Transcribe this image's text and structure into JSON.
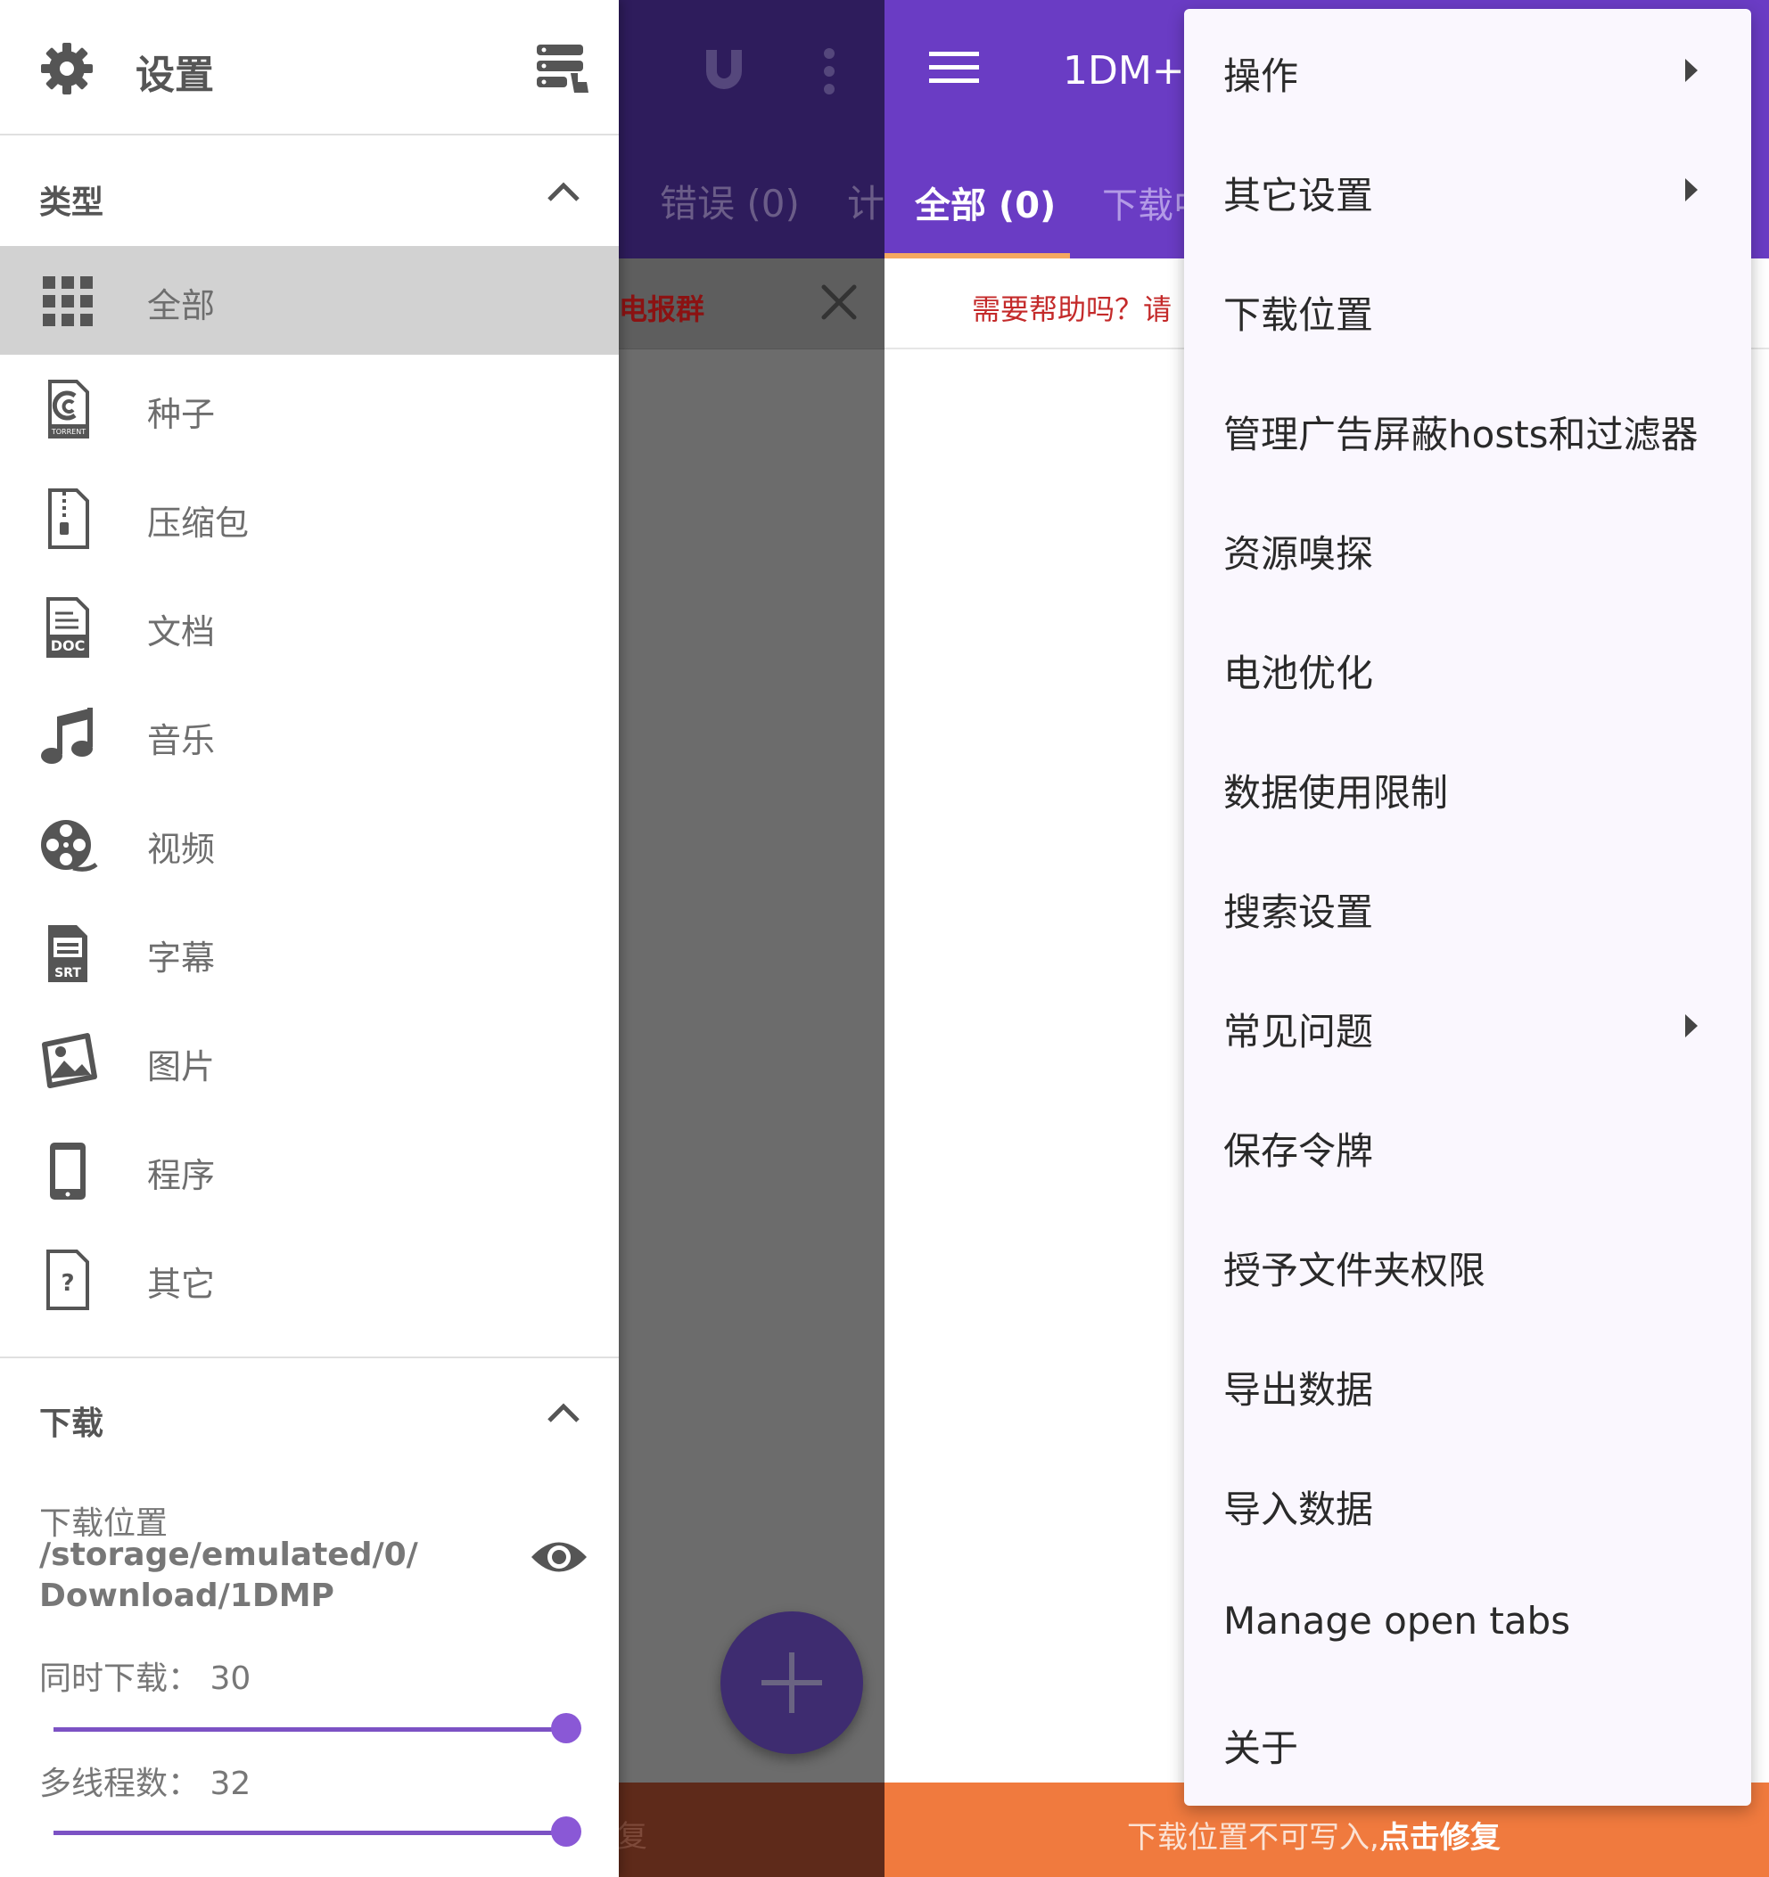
{
  "drawer": {
    "title": "设置",
    "sections": {
      "types_title": "类型",
      "download_title": "下载"
    },
    "categories": [
      {
        "label": "全部",
        "icon": "grid-icon",
        "selected": true
      },
      {
        "label": "种子",
        "icon": "torrent-icon"
      },
      {
        "label": "压缩包",
        "icon": "zip-file-icon"
      },
      {
        "label": "文档",
        "icon": "doc-file-icon"
      },
      {
        "label": "音乐",
        "icon": "music-note-icon"
      },
      {
        "label": "视频",
        "icon": "film-reel-icon"
      },
      {
        "label": "字幕",
        "icon": "srt-file-icon"
      },
      {
        "label": "图片",
        "icon": "image-icon"
      },
      {
        "label": "程序",
        "icon": "phone-icon"
      },
      {
        "label": "其它",
        "icon": "unknown-file-icon"
      }
    ],
    "download": {
      "location_label": "下载位置",
      "location_path_1": "/storage/emulated/0/",
      "location_path_2": "Download/1DMP",
      "concurrent_label": "同时下载：",
      "concurrent_value": "30",
      "threads_label": "多线程数：",
      "threads_value": "32"
    }
  },
  "background_app": {
    "tab_errors": "错误 (0)",
    "tab_partial": "计",
    "banner_text": "电报群",
    "bottom_text": "复"
  },
  "app": {
    "title": "1DM+",
    "tab_all": "全部 (0)",
    "tab_downloading": "下载中",
    "banner_text": "需要帮助吗？请",
    "bottom_text": "下载位置不可写入,",
    "bottom_action": "点击修复"
  },
  "menu": {
    "items": [
      {
        "label": "操作",
        "submenu": true
      },
      {
        "label": "其它设置",
        "submenu": true
      },
      {
        "label": "下载位置"
      },
      {
        "label": "管理广告屏蔽hosts和过滤器"
      },
      {
        "label": "资源嗅探"
      },
      {
        "label": "电池优化"
      },
      {
        "label": "数据使用限制"
      },
      {
        "label": "搜索设置"
      },
      {
        "label": "常见问题",
        "submenu": true
      },
      {
        "label": "保存令牌"
      },
      {
        "label": "授予文件夹权限"
      },
      {
        "label": "导出数据"
      },
      {
        "label": "导入数据"
      },
      {
        "label": "Manage open tabs"
      },
      {
        "label": "关于"
      }
    ]
  },
  "colors": {
    "accent": "#6a3cc4",
    "orange_bar": "#f07a3e",
    "slider": "#8a58d6",
    "error_text": "#c42a2a"
  }
}
